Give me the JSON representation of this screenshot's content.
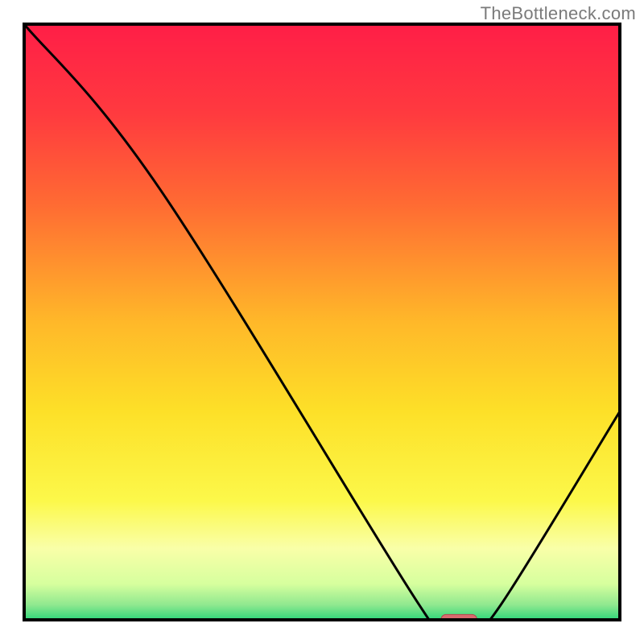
{
  "watermark": "TheBottleneck.com",
  "colors": {
    "frame": "#000000",
    "curve": "#000000",
    "marker_fill": "#d96a6f",
    "marker_stroke": "#b5464c"
  },
  "chart_data": {
    "type": "line",
    "title": "",
    "xlabel": "",
    "ylabel": "",
    "xlim": [
      0,
      100
    ],
    "ylim": [
      0,
      100
    ],
    "gradient_stops": [
      {
        "offset": 0.0,
        "color": "#ff1e47"
      },
      {
        "offset": 0.15,
        "color": "#ff3a3f"
      },
      {
        "offset": 0.3,
        "color": "#ff6a33"
      },
      {
        "offset": 0.5,
        "color": "#ffb829"
      },
      {
        "offset": 0.65,
        "color": "#fde028"
      },
      {
        "offset": 0.8,
        "color": "#fcf84a"
      },
      {
        "offset": 0.88,
        "color": "#f9ffa8"
      },
      {
        "offset": 0.94,
        "color": "#d6ff9e"
      },
      {
        "offset": 0.975,
        "color": "#8fe88f"
      },
      {
        "offset": 1.0,
        "color": "#2fd77a"
      }
    ],
    "curve_points": [
      {
        "x": 0.0,
        "y": 100.0
      },
      {
        "x": 23.0,
        "y": 72.0
      },
      {
        "x": 66.0,
        "y": 3.0
      },
      {
        "x": 70.0,
        "y": 0.0
      },
      {
        "x": 76.0,
        "y": 0.0
      },
      {
        "x": 80.0,
        "y": 2.5
      },
      {
        "x": 100.0,
        "y": 35.0
      }
    ],
    "marker": {
      "x": 73.0,
      "y": 0.0,
      "width": 6.0,
      "height": 1.8
    },
    "notes": "x and y are in percent of the plot area (0 = left/bottom, 100 = right/top). The curve depicts a bottleneck profile that drops from 100 at x=0 to a minimum of 0 around x≈70–76, then rises back to ≈35 at x=100. The pink marker sits at the flat minimum."
  }
}
